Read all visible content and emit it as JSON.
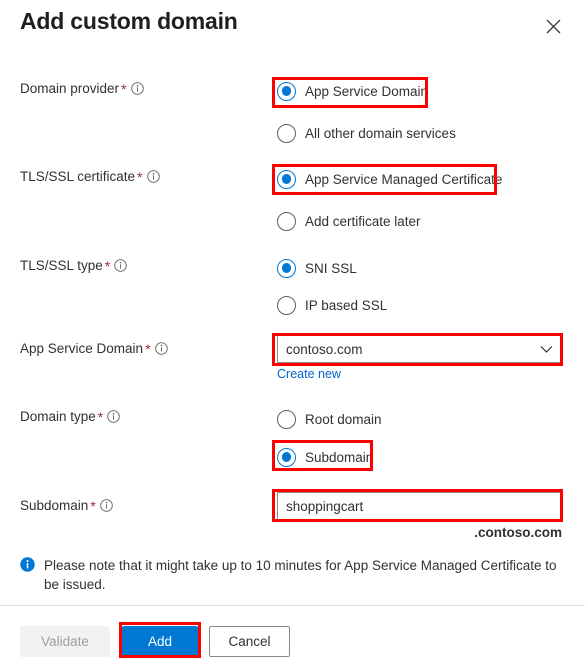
{
  "panel": {
    "title": "Add custom domain",
    "close_icon": "close-icon"
  },
  "fields": {
    "domain_provider": {
      "label": "Domain provider",
      "required_marker": "*",
      "info_icon": "info-icon",
      "options": [
        {
          "label": "App Service Domain",
          "selected": true
        },
        {
          "label": "All other domain services",
          "selected": false
        }
      ]
    },
    "tls_ssl_certificate": {
      "label": "TLS/SSL certificate",
      "required_marker": "*",
      "info_icon": "info-icon",
      "options": [
        {
          "label": "App Service Managed Certificate",
          "selected": true
        },
        {
          "label": "Add certificate later",
          "selected": false
        }
      ]
    },
    "tls_ssl_type": {
      "label": "TLS/SSL type",
      "required_marker": "*",
      "info_icon": "info-icon",
      "options": [
        {
          "label": "SNI SSL",
          "selected": true
        },
        {
          "label": "IP based SSL",
          "selected": false
        }
      ]
    },
    "app_service_domain": {
      "label": "App Service Domain",
      "required_marker": "*",
      "info_icon": "info-icon",
      "value": "contoso.com",
      "chevron_icon": "chevron-down-icon",
      "create_new_link": "Create new"
    },
    "domain_type": {
      "label": "Domain type",
      "required_marker": "*",
      "info_icon": "info-icon",
      "options": [
        {
          "label": "Root domain",
          "selected": false
        },
        {
          "label": "Subdomain",
          "selected": true
        }
      ]
    },
    "subdomain": {
      "label": "Subdomain",
      "required_marker": "*",
      "info_icon": "info-icon",
      "value": "shoppingcart",
      "placeholder": "",
      "suffix": ".contoso.com"
    }
  },
  "banner": {
    "icon": "info-filled-icon",
    "text": "Please note that it might take up to 10 minutes for App Service Managed Certificate to be issued."
  },
  "footer": {
    "validate_label": "Validate",
    "add_label": "Add",
    "cancel_label": "Cancel"
  },
  "colors": {
    "accent": "#0078d4",
    "highlight": "#fe0000",
    "required": "#a4262c",
    "link": "#0066cc",
    "disabled_text": "#a19f9d"
  }
}
